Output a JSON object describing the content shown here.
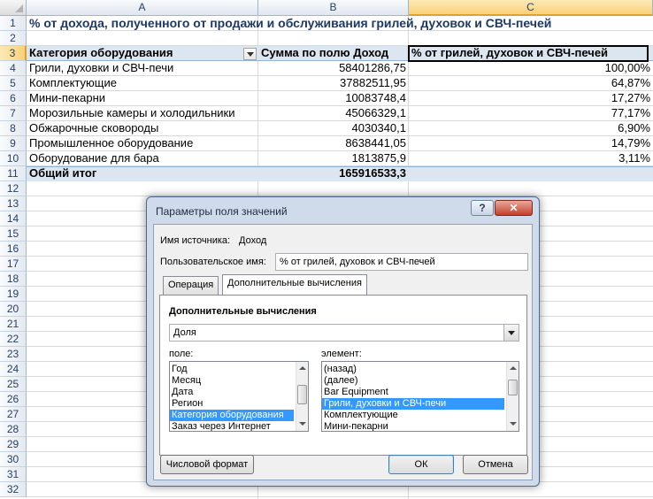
{
  "sheet": {
    "columns": [
      "A",
      "B",
      "C"
    ],
    "selected_column": "C",
    "rows": [
      "1",
      "2",
      "3",
      "4",
      "5",
      "6",
      "7",
      "8",
      "9",
      "10",
      "11",
      "12",
      "13",
      "14",
      "15",
      "16",
      "17",
      "18",
      "19",
      "20",
      "21",
      "22",
      "23",
      "24",
      "25",
      "26",
      "27",
      "28",
      "29",
      "30",
      "31",
      "32"
    ],
    "selected_row": "3",
    "title": "% от дохода, полученного от продажи и обслуживания грилей, духовок и СВЧ-печей",
    "headers": {
      "category": "Категория оборудования",
      "sum": "Сумма по полю Доход",
      "percent": "% от грилей, духовок и СВЧ-печей"
    },
    "data_rows": [
      {
        "category": "Грили, духовки и СВЧ-печи",
        "sum": "58401286,75",
        "percent": "100,00%"
      },
      {
        "category": "Комплектующие",
        "sum": "37882511,95",
        "percent": "64,87%"
      },
      {
        "category": "Мини-пекарни",
        "sum": "10083748,4",
        "percent": "17,27%"
      },
      {
        "category": "Морозильные камеры и холодильники",
        "sum": "45066329,1",
        "percent": "77,17%"
      },
      {
        "category": "Обжарочные сковороды",
        "sum": "4030340,1",
        "percent": "6,90%"
      },
      {
        "category": "Промышленное оборудование",
        "sum": "8638441,05",
        "percent": "14,79%"
      },
      {
        "category": "Оборудование для бара",
        "sum": "1813875,9",
        "percent": "3,11%"
      }
    ],
    "total": {
      "label": "Общий итог",
      "sum": "165916533,3",
      "percent": ""
    }
  },
  "dialog": {
    "title": "Параметры поля значений",
    "help_label": "?",
    "close_label": "✕",
    "source_label": "Имя источника:",
    "source_value": "Доход",
    "custom_name_label": "Пользовательское имя:",
    "custom_name_value": "% от грилей, духовок и СВЧ-печей",
    "tabs": [
      {
        "label": "Операция",
        "active": false
      },
      {
        "label": "Дополнительные вычисления",
        "active": true
      }
    ],
    "section_title": "Дополнительные вычисления",
    "calc_selected": "Доля",
    "field_label": "поле:",
    "field_items": [
      "Год",
      "Месяц",
      "Дата",
      "Регион",
      "Категория оборудования",
      "Заказ через Интернет"
    ],
    "field_selected_index": 4,
    "element_label": "элемент:",
    "element_items": [
      "(назад)",
      "(далее)",
      "Bar Equipment",
      "Грили, духовки и СВЧ-печи",
      "Комплектующие",
      "Мини-пекарни"
    ],
    "element_selected_index": 3,
    "number_format_button": "Числовой формат",
    "ok_button": "ОК",
    "cancel_button": "Отмена",
    "colors": {
      "selection": "#3399ff",
      "header_band": "#dce6f1",
      "title_text": "#1f3864"
    }
  }
}
